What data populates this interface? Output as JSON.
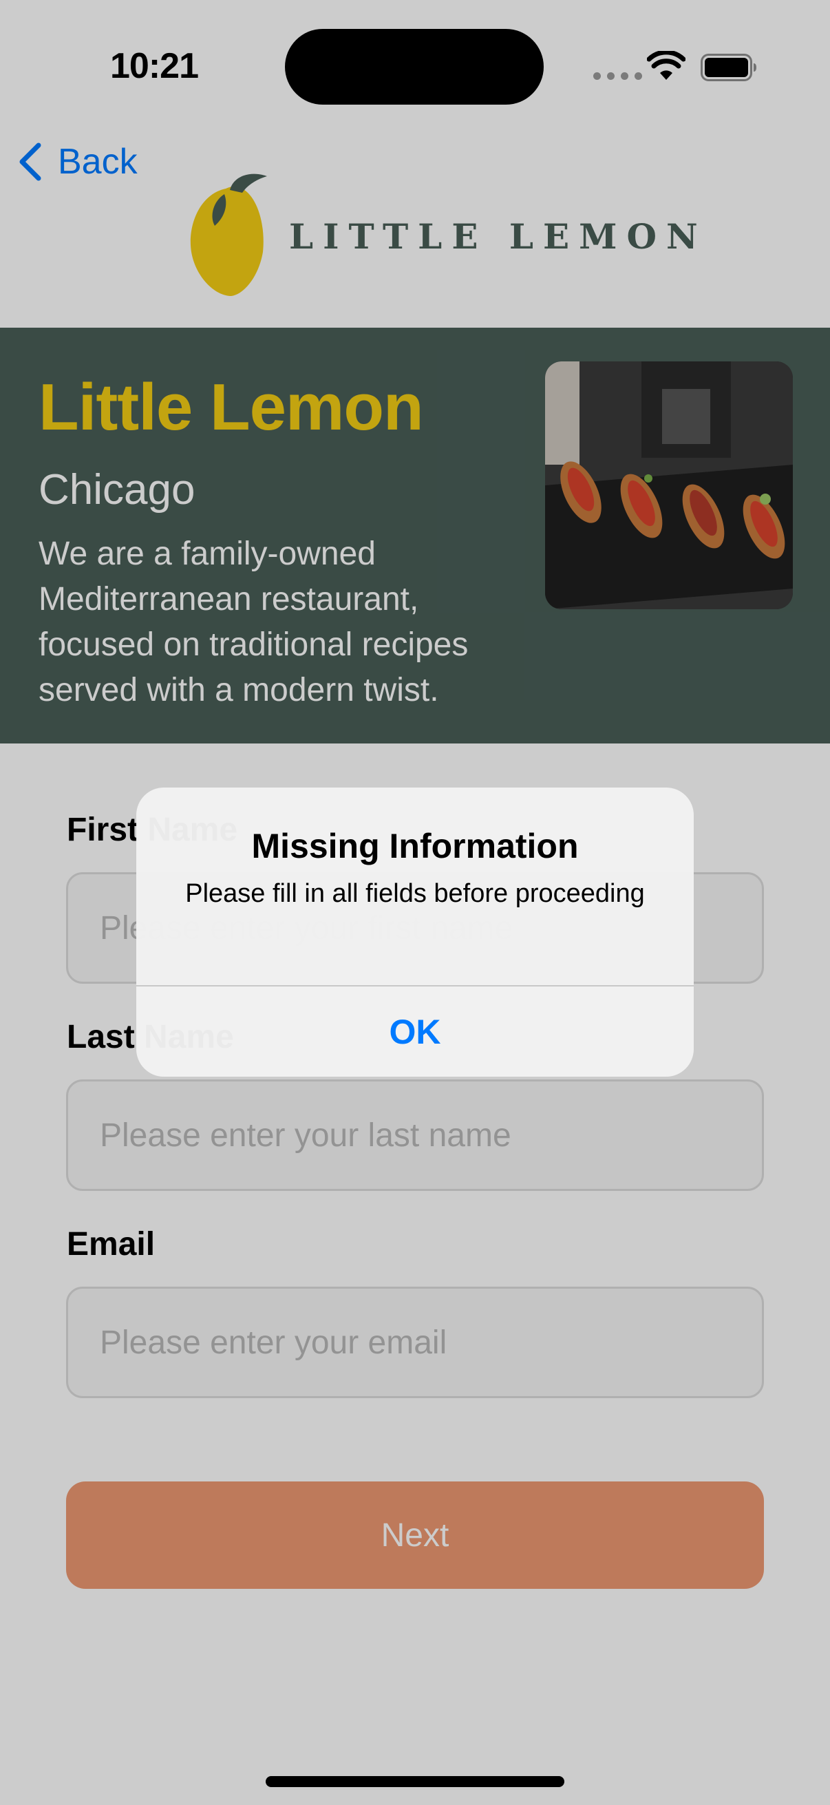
{
  "status_bar": {
    "time": "10:21"
  },
  "nav": {
    "back_label": "Back",
    "logo_text": "LITTLE LEMON"
  },
  "hero": {
    "title": "Little Lemon",
    "city": "Chicago",
    "description": "We are a family-owned Mediterranean restaurant, focused on traditional recipes served with a modern twist."
  },
  "form": {
    "first_name": {
      "label": "First Name",
      "placeholder": "Please enter your first name",
      "value": ""
    },
    "last_name": {
      "label": "Last Name",
      "placeholder": "Please enter your last name",
      "value": ""
    },
    "email": {
      "label": "Email",
      "placeholder": "Please enter your email",
      "value": ""
    },
    "next_label": "Next"
  },
  "alert": {
    "title": "Missing Information",
    "message": "Please fill in all fields before proceeding",
    "ok_label": "OK"
  },
  "colors": {
    "primary_green": "#495e57",
    "primary_yellow": "#f4ce14",
    "accent_orange": "#ee9972",
    "ios_blue": "#007aff"
  },
  "icons": [
    "wifi-icon",
    "battery-icon",
    "signal-icon",
    "chevron-left-icon",
    "lemon-icon"
  ]
}
